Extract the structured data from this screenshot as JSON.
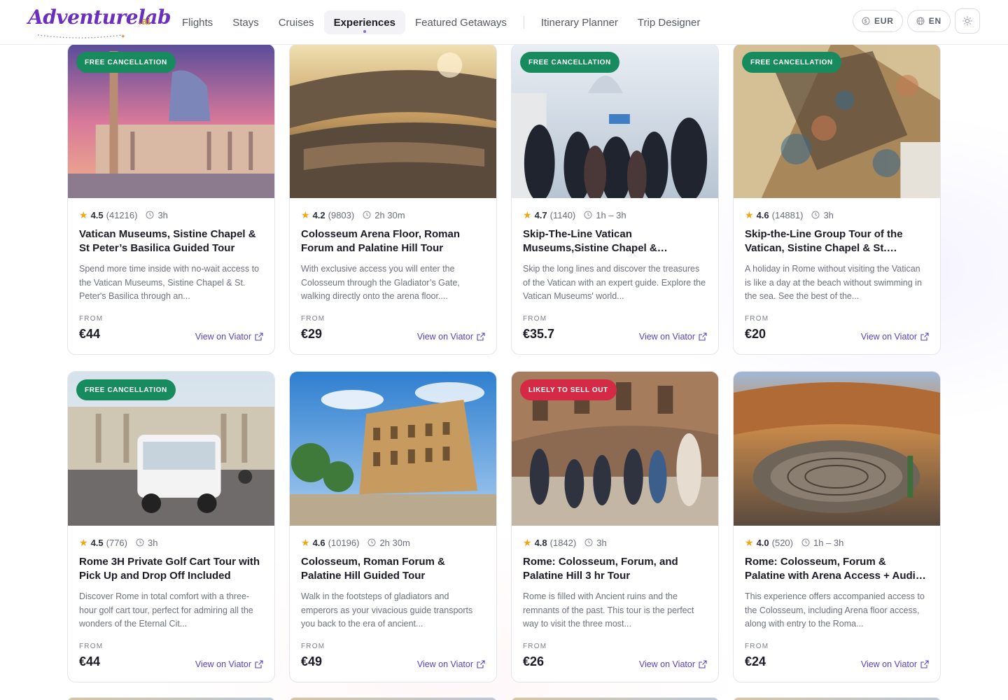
{
  "brand": {
    "name": "Adventurelab",
    "suffix": ".ai"
  },
  "nav": {
    "items": [
      {
        "label": "Flights"
      },
      {
        "label": "Stays"
      },
      {
        "label": "Cruises"
      },
      {
        "label": "Experiences",
        "active": true
      },
      {
        "label": "Featured Getaways"
      },
      {
        "label": "Itinerary Planner"
      },
      {
        "label": "Trip Designer"
      }
    ]
  },
  "header_right": {
    "currency": "EUR",
    "language": "EN",
    "theme_icon": "sun-icon"
  },
  "common": {
    "from_label": "FROM",
    "view_label": "View on Viator",
    "star": "★"
  },
  "cards": [
    {
      "badge": "FREE CANCELLATION",
      "badge_color": "#178a5e",
      "rating": "4.5",
      "reviews": "(41216)",
      "duration": "3h",
      "title": "Vatican Museums, Sistine Chapel & St Peter’s Basilica Guided Tour",
      "description": "Spend more time inside with no-wait access to the Vatican Museums, Sistine Chapel & St. Peter's Basilica through an...",
      "price": "€44"
    },
    {
      "badge": "",
      "badge_color": "",
      "rating": "4.2",
      "reviews": "(9803)",
      "duration": "2h 30m",
      "title": "Colosseum Arena Floor, Roman Forum and Palatine Hill Tour",
      "description": "With exclusive access you will enter the Colosseum through the Gladiator’s Gate, walking directly onto the arena floor....",
      "price": "€29"
    },
    {
      "badge": "FREE CANCELLATION",
      "badge_color": "#178a5e",
      "rating": "4.7",
      "reviews": "(1140)",
      "duration": "1h – 3h",
      "title": "Skip-The-Line Vatican Museums,Sistine Chapel & Optional...",
      "description": "Skip the long lines and discover the treasures of the Vatican with an expert guide. Explore the Vatican Museums' world...",
      "price": "€35.7"
    },
    {
      "badge": "FREE CANCELLATION",
      "badge_color": "#178a5e",
      "rating": "4.6",
      "reviews": "(14881)",
      "duration": "3h",
      "title": "Skip-the-Line Group Tour of the Vatican, Sistine Chapel & St. Peter's...",
      "description": "A holiday in Rome without visiting the Vatican is like a day at the beach without swimming in the sea. See the best of the...",
      "price": "€20"
    },
    {
      "badge": "FREE CANCELLATION",
      "badge_color": "#178a5e",
      "rating": "4.5",
      "reviews": "(776)",
      "duration": "3h",
      "title": "Rome 3H Private Golf Cart Tour with Pick Up and Drop Off Included",
      "description": "Discover Rome in total comfort with a three-hour golf cart tour, perfect for admiring all the wonders of the Eternal Cit...",
      "price": "€44"
    },
    {
      "badge": "",
      "badge_color": "",
      "rating": "4.6",
      "reviews": "(10196)",
      "duration": "2h 30m",
      "title": "Colosseum, Roman Forum & Palatine Hill Guided Tour",
      "description": "Walk in the footsteps of gladiators and emperors as your vivacious guide transports you back to the era of ancient...",
      "price": "€49"
    },
    {
      "badge": "LIKELY TO SELL OUT",
      "badge_color": "#d42a45",
      "rating": "4.8",
      "reviews": "(1842)",
      "duration": "3h",
      "title": "Rome: Colosseum, Forum, and Palatine Hill 3 hr Tour",
      "description": "Rome is filled with Ancient ruins and the remnants of the past. This tour is the perfect way to visit the three most...",
      "price": "€26"
    },
    {
      "badge": "",
      "badge_color": "",
      "rating": "4.0",
      "reviews": "(520)",
      "duration": "1h – 3h",
      "title": "Rome: Colosseum, Forum & Palatine with Arena Access + Audio Guide",
      "description": "This experience offers accompanied access to the Colosseum, including Arena floor access, along with entry to the Roma...",
      "price": "€24"
    }
  ]
}
